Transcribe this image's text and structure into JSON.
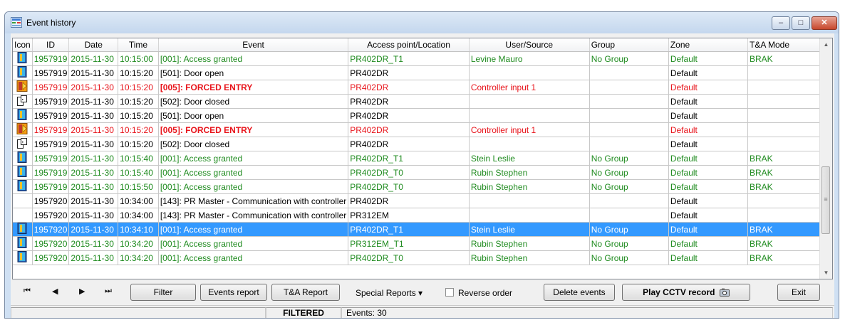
{
  "window": {
    "title": "Event history",
    "minimize": "‒",
    "maximize": "□",
    "close": "✕"
  },
  "columns": [
    "Icon",
    "ID",
    "Date",
    "Time",
    "Event",
    "Access point/Location",
    "User/Source",
    "Group",
    "Zone",
    "T&A Mode"
  ],
  "rows": [
    {
      "icon": "door-open-icon",
      "color": "green",
      "id": "1957919",
      "date": "2015-11-30",
      "time": "10:15:00",
      "event": "[001]: Access granted",
      "location": "PR402DR_T1",
      "user": "Levine Mauro",
      "group": "No Group",
      "zone": "Default",
      "mode": "BRAK"
    },
    {
      "icon": "door-open-icon",
      "color": "black",
      "id": "1957919",
      "date": "2015-11-30",
      "time": "10:15:20",
      "event": "[501]: Door open",
      "location": "PR402DR",
      "user": "",
      "group": "",
      "zone": "Default",
      "mode": ""
    },
    {
      "icon": "forced-entry-icon",
      "color": "red",
      "id": "1957919",
      "date": "2015-11-30",
      "time": "10:15:20",
      "event": "[005]: FORCED ENTRY",
      "location": "PR402DR",
      "user": "Controller input 1",
      "group": "",
      "zone": "Default",
      "mode": ""
    },
    {
      "icon": "door-closed-icon",
      "color": "black",
      "id": "1957919",
      "date": "2015-11-30",
      "time": "10:15:20",
      "event": "[502]: Door closed",
      "location": "PR402DR",
      "user": "",
      "group": "",
      "zone": "Default",
      "mode": ""
    },
    {
      "icon": "door-open-icon",
      "color": "black",
      "id": "1957919",
      "date": "2015-11-30",
      "time": "10:15:20",
      "event": "[501]: Door open",
      "location": "PR402DR",
      "user": "",
      "group": "",
      "zone": "Default",
      "mode": ""
    },
    {
      "icon": "forced-entry-icon",
      "color": "red",
      "id": "1957919",
      "date": "2015-11-30",
      "time": "10:15:20",
      "event": "[005]: FORCED ENTRY",
      "location": "PR402DR",
      "user": "Controller input 1",
      "group": "",
      "zone": "Default",
      "mode": ""
    },
    {
      "icon": "door-closed-icon",
      "color": "black",
      "id": "1957919",
      "date": "2015-11-30",
      "time": "10:15:20",
      "event": "[502]: Door closed",
      "location": "PR402DR",
      "user": "",
      "group": "",
      "zone": "Default",
      "mode": ""
    },
    {
      "icon": "door-open-icon",
      "color": "green",
      "id": "1957919",
      "date": "2015-11-30",
      "time": "10:15:40",
      "event": "[001]: Access granted",
      "location": "PR402DR_T1",
      "user": "Stein Leslie",
      "group": "No Group",
      "zone": "Default",
      "mode": "BRAK"
    },
    {
      "icon": "door-open-icon",
      "color": "green",
      "id": "1957919",
      "date": "2015-11-30",
      "time": "10:15:40",
      "event": "[001]: Access granted",
      "location": "PR402DR_T0",
      "user": "Rubin Stephen",
      "group": "No Group",
      "zone": "Default",
      "mode": "BRAK"
    },
    {
      "icon": "door-open-icon",
      "color": "green",
      "id": "1957919",
      "date": "2015-11-30",
      "time": "10:15:50",
      "event": "[001]: Access granted",
      "location": "PR402DR_T0",
      "user": "Rubin Stephen",
      "group": "No Group",
      "zone": "Default",
      "mode": "BRAK"
    },
    {
      "icon": "",
      "color": "black",
      "id": "1957920",
      "date": "2015-11-30",
      "time": "10:34:00",
      "event": "[143]: PR Master - Communication with controller",
      "location": "PR402DR",
      "user": "",
      "group": "",
      "zone": "Default",
      "mode": ""
    },
    {
      "icon": "",
      "color": "black",
      "id": "1957920",
      "date": "2015-11-30",
      "time": "10:34:00",
      "event": "[143]: PR Master - Communication with controller",
      "location": "PR312EM",
      "user": "",
      "group": "",
      "zone": "Default",
      "mode": ""
    },
    {
      "icon": "door-open-icon",
      "color": "sel",
      "id": "1957920",
      "date": "2015-11-30",
      "time": "10:34:10",
      "event": "[001]: Access granted",
      "location": "PR402DR_T1",
      "user": "Stein Leslie",
      "group": "No Group",
      "zone": "Default",
      "mode": "BRAK"
    },
    {
      "icon": "door-open-icon",
      "color": "green",
      "id": "1957920",
      "date": "2015-11-30",
      "time": "10:34:20",
      "event": "[001]: Access granted",
      "location": "PR312EM_T1",
      "user": "Rubin Stephen",
      "group": "No Group",
      "zone": "Default",
      "mode": "BRAK"
    },
    {
      "icon": "door-open-icon",
      "color": "green",
      "id": "1957920",
      "date": "2015-11-30",
      "time": "10:34:20",
      "event": "[001]: Access granted",
      "location": "PR402DR_T0",
      "user": "Rubin Stephen",
      "group": "No Group",
      "zone": "Default",
      "mode": "BRAK"
    }
  ],
  "toolbar": {
    "first": "⏮",
    "prev": "◀",
    "next": "▶",
    "last": "⏭",
    "filter": "Filter",
    "events_report": "Events report",
    "ta_report": "T&A Report",
    "special_reports": "Special Reports ▾",
    "reverse_order": "Reverse order",
    "delete_events": "Delete events",
    "play_cctv": "Play CCTV record",
    "exit": "Exit"
  },
  "status": {
    "filtered": "FILTERED",
    "events": "Events: 30"
  },
  "colors": {
    "green": "#1f8b1f",
    "red": "#e8141b",
    "selected": "#3399ff"
  }
}
